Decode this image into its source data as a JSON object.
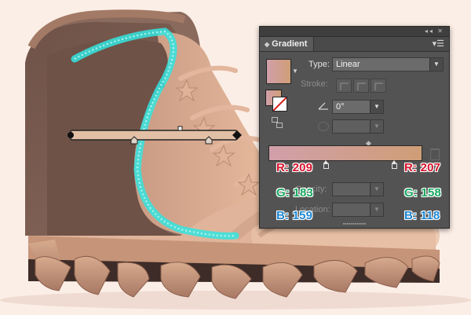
{
  "panel": {
    "title": "Gradient",
    "type_label": "Type:",
    "type_value": "Linear",
    "stroke_label": "Stroke:",
    "angle_value": "0°",
    "opacity_label": "Opacity:",
    "location_label": "Location:"
  },
  "gradient": {
    "start_color": "#d19faa",
    "end_color": "#cf9e76"
  },
  "colors": {
    "left": {
      "r": "R: 209",
      "g": "G: 183",
      "b": "B: 159"
    },
    "right": {
      "r": "R: 207",
      "g": "G: 158",
      "b": "B: 118"
    }
  },
  "accents": {
    "red": "#d6142c",
    "green": "#17a760",
    "blue": "#1c87d3",
    "selection": "#35e5e0"
  }
}
